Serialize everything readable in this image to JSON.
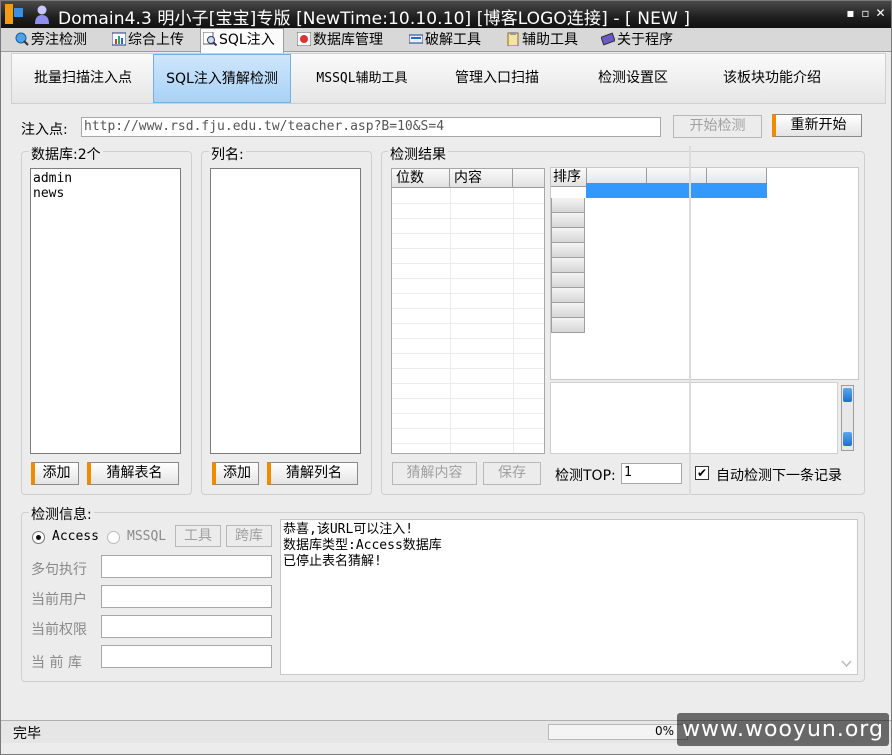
{
  "window": {
    "title": "Domain4.3 明小子[宝宝]专版 [NewTime:10.10.10] [博客LOGO连接]  - [ NEW ]",
    "minimize": "▪",
    "maximize": "▫",
    "close": "✕"
  },
  "main_tabs": [
    {
      "label": "旁注检测",
      "icon": "globe-search-icon"
    },
    {
      "label": "综合上传",
      "icon": "chart-icon"
    },
    {
      "label": "SQL注入",
      "icon": "magnifier-icon"
    },
    {
      "label": "数据库管理",
      "icon": "database-icon"
    },
    {
      "label": "破解工具",
      "icon": "keyboard-icon"
    },
    {
      "label": "辅助工具",
      "icon": "clipboard-icon"
    },
    {
      "label": "关于程序",
      "icon": "books-icon"
    }
  ],
  "sub_tabs": [
    "批量扫描注入点",
    "SQL注入猜解检测",
    "MSSQL辅助工具",
    "管理入口扫描",
    "检测设置区",
    "该板块功能介绍"
  ],
  "injection": {
    "label": "注入点:",
    "url": "http://www.rsd.fju.edu.tw/teacher.asp?B=10&S=4",
    "start_button": "开始检测",
    "restart_button": "重新开始"
  },
  "database": {
    "label": "数据库:2个",
    "items": [
      "admin",
      "news"
    ],
    "add_button": "添加",
    "guess_button": "猜解表名"
  },
  "columns": {
    "label": "列名:",
    "add_button": "添加",
    "guess_button": "猜解列名"
  },
  "results": {
    "label": "检测结果",
    "grid_headers": [
      "位数",
      "内容"
    ],
    "sort_header": "排序",
    "guess_content_button": "猜解内容",
    "save_button": "保存",
    "top_label": "检测TOP:",
    "top_value": "1",
    "auto_check_label": "自动检测下一条记录",
    "auto_check_checked": true,
    "check_mark": "✔"
  },
  "info": {
    "label": "检测信息:",
    "radio_access": "Access",
    "radio_mssql": "MSSQL",
    "tool_button": "工具",
    "cross_db_button": "跨库",
    "multi_exec_label": "多句执行",
    "current_user_label": "当前用户",
    "current_perm_label": "当前权限",
    "current_db_label": "当 前 库",
    "log_lines": [
      "恭喜,该URL可以注入!",
      "数据库类型:Access数据库",
      "已停止表名猜解!"
    ]
  },
  "status": {
    "text": "完毕",
    "percent": "0%",
    "progress": 0
  },
  "watermark": "www.wooyun.org",
  "colors": {
    "accent_orange": "#f08a00",
    "selection_blue": "#3399ff",
    "active_subtab": "#a8d2f6"
  }
}
